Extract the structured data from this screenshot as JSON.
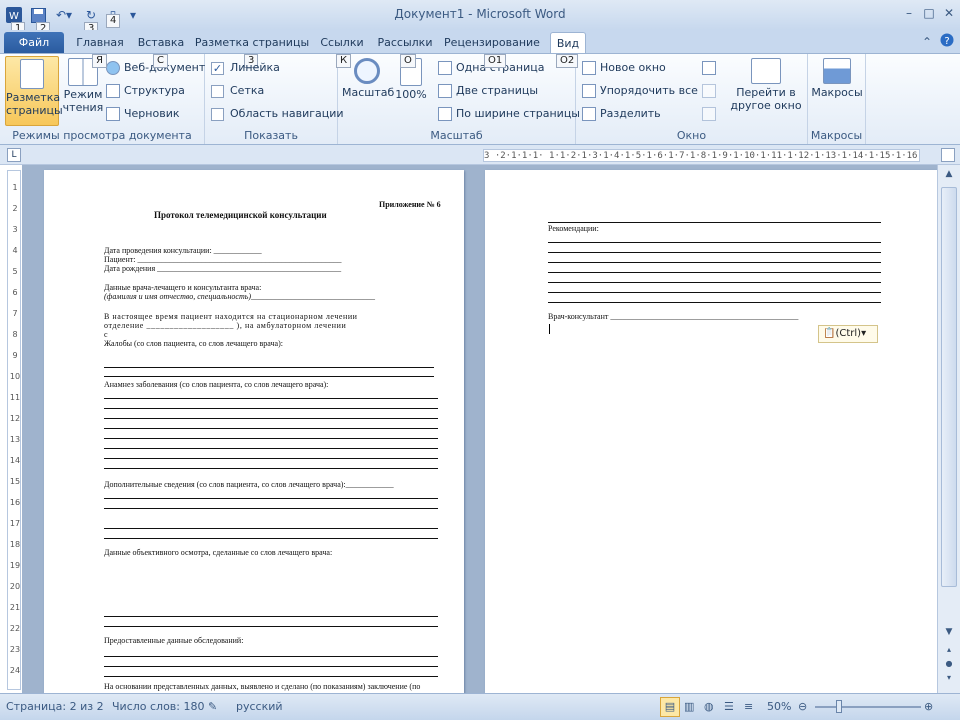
{
  "window": {
    "title": "Документ1 - Microsoft Word",
    "controls": [
      "–",
      "□",
      "✕"
    ]
  },
  "quick_access": {
    "keytips": [
      "1",
      "2",
      "3",
      "4"
    ]
  },
  "tabs": [
    {
      "label": "Файл",
      "keytip": ""
    },
    {
      "label": "Главная",
      "keytip": ""
    },
    {
      "label": "Вставка",
      "keytip": ""
    },
    {
      "label": "Разметка страницы",
      "keytip": ""
    },
    {
      "label": "Ссылки",
      "keytip": ""
    },
    {
      "label": "Рассылки",
      "keytip": ""
    },
    {
      "label": "Рецензирование",
      "keytip": ""
    },
    {
      "label": "Вид",
      "keytip": ""
    }
  ],
  "ribbon": {
    "keytips": {
      "read": "Я",
      "web": "С",
      "print_layout": "3",
      "zoom": "К",
      "hundred": "О",
      "one_page": "О1",
      "two_pages": "О2"
    },
    "views_group": {
      "label": "Режимы просмотра документа",
      "print_layout": "Разметка страницы",
      "reading": "Режим чтения",
      "web": "Веб-документ",
      "outline": "Структура",
      "draft": "Черновик"
    },
    "show_group": {
      "label": "Показать",
      "ruler": "Линейка",
      "grid": "Сетка",
      "nav_pane": "Область навигации",
      "ruler_checked": "✓"
    },
    "zoom_group": {
      "label": "Масштаб",
      "zoom": "Масштаб",
      "hundred": "100%",
      "one_page": "Одна страница",
      "two_pages": "Две страницы",
      "page_width": "По ширине страницы"
    },
    "window_group": {
      "label": "Окно",
      "new_window": "Новое окно",
      "arrange_all": "Упорядочить все",
      "split": "Разделить",
      "switch": "Перейти в другое окно"
    },
    "macros_group": {
      "label": "Макросы",
      "macros": "Макросы"
    }
  },
  "ruler": {
    "h_text": "3 ·2·1·1·1·  1·1·2·1·3·1·4·1·5·1·6·1·7·1·8·1·9·1·10·1·11·1·12·1·13·1·14·1·15·1·16·17·1",
    "v_ticks": [
      "1",
      "2",
      "3",
      "4",
      "5",
      "6",
      "7",
      "8",
      "9",
      "10",
      "11",
      "12",
      "13",
      "14",
      "15",
      "16",
      "17",
      "18",
      "19",
      "20",
      "21",
      "22",
      "23",
      "24"
    ]
  },
  "page1": {
    "appendix": "Приложение № 6",
    "heading": "Протокол телемедицинской консультации",
    "date": "Дата проведения консультации: ____________",
    "patient": "Пациент: ___________________________________________________",
    "birth": "Дата рождения ______________________________________________",
    "doctor": "Данные врача-лечащего и консультанта врача:",
    "doctor_sub": "(фамилия и имя отчество, специальность)_______________________________",
    "p1": "В настоящее время пациент находится на стационарном лечении",
    "p2": "отделение ___________________ ), на амбулаторном лечении",
    "p3": "с",
    "complaints": "Жалобы (со слов пациента, со слов лечащего врача):",
    "anamnesis": "Анамнез заболевания (со слов пациента, со слов лечащего врача):",
    "additional": "Дополнительные сведения (со слов пациента, со слов лечащего врача):____________",
    "objective": "Данные объективного осмотра, сделанные со слов лечащего врача:",
    "exams": "Предоставленные данные обследований:",
    "footer": "На основании представленных данных, выявлено и сделано (по показаниям) заключение (по"
  },
  "page2": {
    "recommendations": "Рекомендации:",
    "consultant": "Врач-консультант _______________________________________________",
    "paste_label": "(Ctrl)"
  },
  "status": {
    "page": "Страница: 2 из 2",
    "words": "Число слов: 180",
    "language": "русский",
    "zoom": "50%"
  }
}
